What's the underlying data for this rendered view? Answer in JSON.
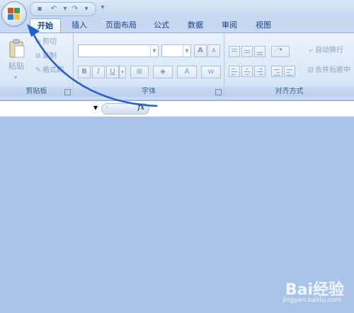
{
  "quick_access": {
    "save_icon": "save-icon",
    "undo_icon": "undo-icon",
    "redo_icon": "redo-icon"
  },
  "tabs": [
    {
      "label": "开始",
      "active": true
    },
    {
      "label": "插入"
    },
    {
      "label": "页面布局"
    },
    {
      "label": "公式"
    },
    {
      "label": "数据"
    },
    {
      "label": "审阅"
    },
    {
      "label": "视图"
    }
  ],
  "clipboard": {
    "paste_label": "粘贴",
    "cut_label": "剪切",
    "copy_label": "复制",
    "format_painter_label": "格式刷",
    "group_label": "剪贴板"
  },
  "font": {
    "bold": "B",
    "italic": "I",
    "underline": "U",
    "grow": "A",
    "shrink": "A",
    "font_color": "A",
    "phonetic": "ｗ",
    "group_label": "字体"
  },
  "alignment": {
    "wrap_text_label": "自动换行",
    "merge_label": "合并后居中",
    "group_label": "对齐方式"
  },
  "formula_bar": {
    "fx_label": "fx"
  },
  "watermark": {
    "brand": "Bai经验",
    "url": "jingyan.baidu.com"
  },
  "colors": {
    "accent": "#1f5fd6",
    "ribbon": "#d9e7f7",
    "workspace": "#a9c4e8"
  }
}
